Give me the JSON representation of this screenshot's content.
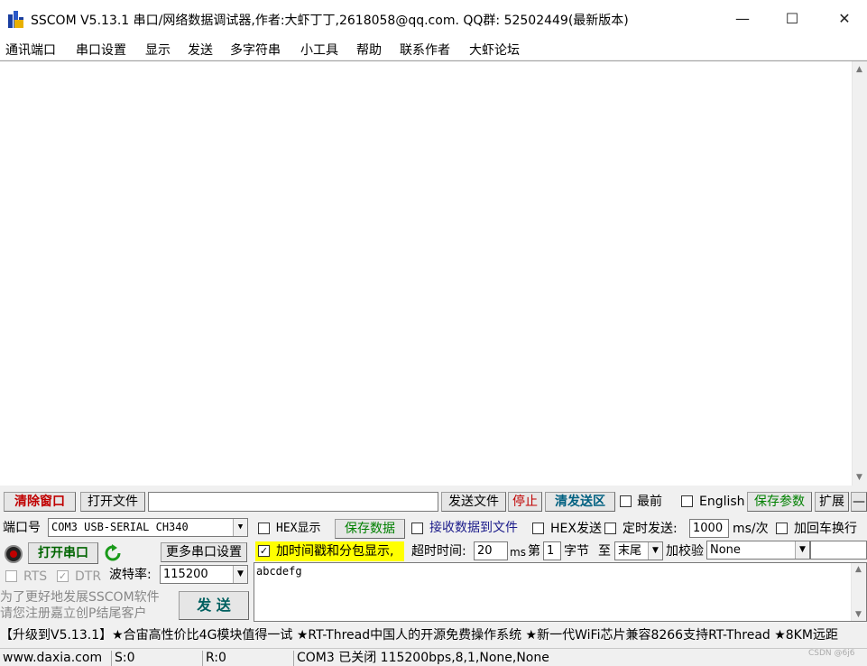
{
  "window": {
    "title": "SSCOM V5.13.1 串口/网络数据调试器,作者:大虾丁丁,2618058@qq.com. QQ群: 52502449(最新版本)",
    "minimize": "—",
    "maximize": "☐",
    "close": "✕"
  },
  "menu": [
    "通讯端口",
    "串口设置",
    "显示",
    "发送",
    "多字符串",
    "小工具",
    "帮助",
    "联系作者",
    "大虾论坛"
  ],
  "toolbar": {
    "clear_window": "清除窗口",
    "open_file": "打开文件",
    "file_path": "",
    "send_file": "发送文件",
    "stop": "停止",
    "clear_send": "清发送区",
    "topmost_label": "最前",
    "english_label": "English",
    "save_params": "保存参数",
    "expand": "扩展",
    "collapse": "—"
  },
  "port": {
    "label": "端口号",
    "value": "COM3 USB-SERIAL CH340",
    "open_button": "打开串口",
    "more_settings": "更多串口设置",
    "rts": "RTS",
    "dtr": "DTR",
    "baud_label": "波特率:",
    "baud_value": "115200"
  },
  "options": {
    "hex_display": "HEX显示",
    "save_data": "保存数据",
    "recv_to_file": "接收数据到文件",
    "hex_send": "HEX发送",
    "timed_send": "定时发送:",
    "interval": "1000",
    "interval_unit": "ms/次",
    "add_crlf": "加回车换行",
    "timestamp": "加时间戳和分包显示,",
    "timeout_label": "超时时间:",
    "timeout": "20",
    "timeout_unit": "ms",
    "byte_prefix": "第",
    "byte_index": "1",
    "byte_suffix": "字节",
    "to_label": "至",
    "to_value": "末尾",
    "checksum_label": "加校验",
    "checksum_value": "None"
  },
  "send": {
    "text": "abcdefg",
    "button": "发 送",
    "promo": "为了更好地发展SSCOM软件\n请您注册嘉立创P结尾客户"
  },
  "ticker": "【升级到V5.13.1】★合宙高性价比4G模块值得一试 ★RT-Thread中国人的开源免费操作系统 ★新一代WiFi芯片兼容8266支持RT-Thread ★8KM远距",
  "status": {
    "site": "www.daxia.com",
    "sent": "S:0",
    "recv": "R:0",
    "state": "COM3 已关闭  115200bps,8,1,None,None",
    "watermark": "CSDN @6j6"
  },
  "colors": {
    "accent_red": "#c00000",
    "accent_green": "#008000",
    "highlight_yellow": "#ffff00"
  }
}
